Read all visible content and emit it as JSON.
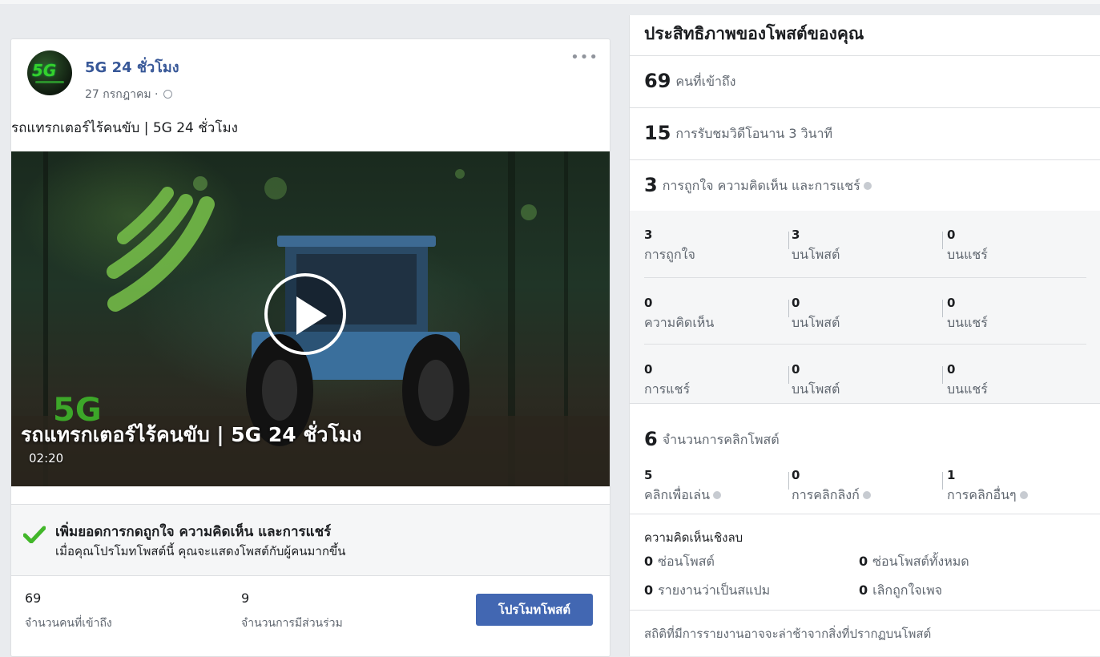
{
  "post": {
    "page_name": "5G 24 ชั่วโมง",
    "avatar_text": "5G",
    "date": "27 กรกฎาคม · ",
    "caption": "รถแทรกเตอร์ไร้คนขับ | 5G 24 ชั่วโมง",
    "more_label": "•••",
    "video": {
      "title": "รถแทรกเตอร์ไร้คนขับ | 5G 24 ชั่วโมง",
      "overlay_logo": "5G",
      "duration": "02:20"
    },
    "promo": {
      "title": "เพิ่มยอดการกดถูกใจ ความคิดเห็น และการแชร์",
      "subtitle": "เมื่อคุณโปรโมทโพสต์นี้ คุณจะแสดงโพสต์กับผู้คนมากขึ้น"
    },
    "stats": [
      {
        "value": "69",
        "label": "จำนวนคนที่เข้าถึง"
      },
      {
        "value": "9",
        "label": "จำนวนการมีส่วนร่วม"
      }
    ],
    "promote_button": "โปรโมทโพสต์"
  },
  "insights": {
    "title": "ประสิทธิภาพของโพสต์ของคุณ",
    "reach": {
      "value": "69",
      "label": "คนที่เข้าถึง"
    },
    "views": {
      "value": "15",
      "label": "การรับชมวิดีโอนาน 3 วินาที"
    },
    "engagement": {
      "value": "3",
      "label": "การถูกใจ ความคิดเห็น และการแชร์"
    },
    "breakdown": [
      {
        "value": "3",
        "label": "การถูกใจ",
        "on_post": "3",
        "on_post_label": "บนโพสต์",
        "on_share": "0",
        "on_share_label": "บนแชร์"
      },
      {
        "value": "0",
        "label": "ความคิดเห็น",
        "on_post": "0",
        "on_post_label": "บนโพสต์",
        "on_share": "0",
        "on_share_label": "บนแชร์"
      },
      {
        "value": "0",
        "label": "การแชร์",
        "on_post": "0",
        "on_post_label": "บนโพสต์",
        "on_share": "0",
        "on_share_label": "บนแชร์"
      }
    ],
    "clicks": {
      "value": "6",
      "label": "จำนวนการคลิกโพสต์"
    },
    "click_breakdown": [
      {
        "value": "5",
        "label": "คลิกเพื่อเล่น"
      },
      {
        "value": "0",
        "label": "การคลิกลิงก์"
      },
      {
        "value": "1",
        "label": "การคลิกอื่นๆ"
      }
    ],
    "negative": {
      "title": "ความคิดเห็นเชิงลบ",
      "items": [
        {
          "value": "0",
          "label": "ซ่อนโพสต์"
        },
        {
          "value": "0",
          "label": "ซ่อนโพสต์ทั้งหมด"
        },
        {
          "value": "0",
          "label": "รายงานว่าเป็นสแปม"
        },
        {
          "value": "0",
          "label": "เลิกถูกใจเพจ"
        }
      ]
    },
    "footnote": "สถิติที่มีการรายงานอาจจะล่าช้าจากสิ่งที่ปรากฏบนโพสต์"
  },
  "colors": {
    "link": "#385898",
    "button": "#4267b2",
    "check": "#42b72a",
    "page_bg": "#e9ebee"
  }
}
